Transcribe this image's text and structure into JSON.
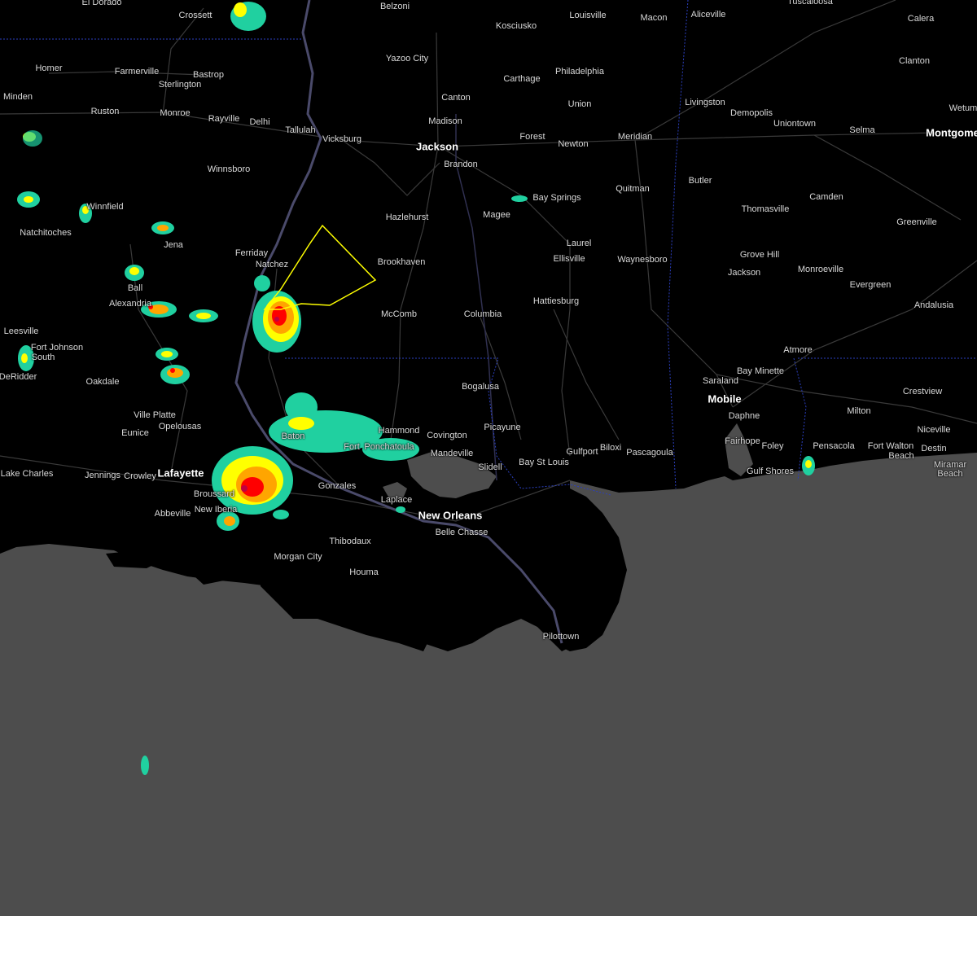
{
  "map": {
    "colors": {
      "land": "#000000",
      "water": "#4d4d4d",
      "roads": "#3a3a3a",
      "state_border": "#2b3fbf",
      "warning_polygon": "#ffff00",
      "label": "#d9d9d9"
    },
    "radar_color_scale": [
      "#18a884",
      "#20d0a0",
      "#ffff00",
      "#ffa500",
      "#ff0000",
      "#c00040"
    ],
    "cities": [
      {
        "name": "El Dorado",
        "major": false
      },
      {
        "name": "Crossett",
        "major": false
      },
      {
        "name": "Belzoni",
        "major": false
      },
      {
        "name": "Kosciusko",
        "major": false
      },
      {
        "name": "Louisville",
        "major": false
      },
      {
        "name": "Macon",
        "major": false
      },
      {
        "name": "Aliceville",
        "major": false
      },
      {
        "name": "Tuscaloosa",
        "major": false
      },
      {
        "name": "Calera",
        "major": false
      },
      {
        "name": "Clanton",
        "major": false
      },
      {
        "name": "Wetum",
        "major": false
      },
      {
        "name": "Montgome",
        "major": true
      },
      {
        "name": "Yazoo City",
        "major": false
      },
      {
        "name": "Homer",
        "major": false
      },
      {
        "name": "Farmerville",
        "major": false
      },
      {
        "name": "Bastrop",
        "major": false
      },
      {
        "name": "Sterlington",
        "major": false
      },
      {
        "name": "Minden",
        "major": false
      },
      {
        "name": "Ruston",
        "major": false
      },
      {
        "name": "Monroe",
        "major": false
      },
      {
        "name": "Rayville",
        "major": false
      },
      {
        "name": "Delhi",
        "major": false
      },
      {
        "name": "Tallulah",
        "major": false
      },
      {
        "name": "Vicksburg",
        "major": false
      },
      {
        "name": "Jackson",
        "major": true
      },
      {
        "name": "Canton",
        "major": false
      },
      {
        "name": "Madison",
        "major": false
      },
      {
        "name": "Carthage",
        "major": false
      },
      {
        "name": "Philadelphia",
        "major": false
      },
      {
        "name": "Union",
        "major": false
      },
      {
        "name": "Forest",
        "major": false
      },
      {
        "name": "Newton",
        "major": false
      },
      {
        "name": "Meridian",
        "major": false
      },
      {
        "name": "Livingston",
        "major": false
      },
      {
        "name": "Demopolis",
        "major": false
      },
      {
        "name": "Uniontown",
        "major": false
      },
      {
        "name": "Selma",
        "major": false
      },
      {
        "name": "Brandon",
        "major": false
      },
      {
        "name": "Winnsboro",
        "major": false
      },
      {
        "name": "Winnfield",
        "major": false
      },
      {
        "name": "Natchitoches",
        "major": false
      },
      {
        "name": "Jena",
        "major": false
      },
      {
        "name": "Ferriday",
        "major": false
      },
      {
        "name": "Natchez",
        "major": false
      },
      {
        "name": "Hazlehurst",
        "major": false
      },
      {
        "name": "Magee",
        "major": false
      },
      {
        "name": "Bay Springs",
        "major": false
      },
      {
        "name": "Quitman",
        "major": false
      },
      {
        "name": "Butler",
        "major": false
      },
      {
        "name": "Thomasville",
        "major": false
      },
      {
        "name": "Camden",
        "major": false
      },
      {
        "name": "Greenville",
        "major": false
      },
      {
        "name": "Brookhaven",
        "major": false
      },
      {
        "name": "Laurel",
        "major": false
      },
      {
        "name": "Ellisville",
        "major": false
      },
      {
        "name": "Waynesboro",
        "major": false
      },
      {
        "name": "Grove Hill",
        "major": false
      },
      {
        "name": "Jackson",
        "major": false
      },
      {
        "name": "Monroeville",
        "major": false
      },
      {
        "name": "Evergreen",
        "major": false
      },
      {
        "name": "Ball",
        "major": false
      },
      {
        "name": "Alexandria",
        "major": false
      },
      {
        "name": "McComb",
        "major": false
      },
      {
        "name": "Columbia",
        "major": false
      },
      {
        "name": "Hattiesburg",
        "major": false
      },
      {
        "name": "Andalusia",
        "major": false
      },
      {
        "name": "Leesville",
        "major": false
      },
      {
        "name": "Fort Johnson",
        "major": false
      },
      {
        "name": "South",
        "major": false
      },
      {
        "name": "DeRidder",
        "major": false
      },
      {
        "name": "Oakdale",
        "major": false
      },
      {
        "name": "Bogalusa",
        "major": false
      },
      {
        "name": "Atmore",
        "major": false
      },
      {
        "name": "Saraland",
        "major": false
      },
      {
        "name": "Bay Minette",
        "major": false
      },
      {
        "name": "Mobile",
        "major": true
      },
      {
        "name": "Crestview",
        "major": false
      },
      {
        "name": "Ville Platte",
        "major": false
      },
      {
        "name": "Opelousas",
        "major": false
      },
      {
        "name": "Eunice",
        "major": false
      },
      {
        "name": "Hammond",
        "major": false
      },
      {
        "name": "Covington",
        "major": false
      },
      {
        "name": "Mandeville",
        "major": false
      },
      {
        "name": "Picayune",
        "major": false
      },
      {
        "name": "Daphne",
        "major": false
      },
      {
        "name": "Milton",
        "major": false
      },
      {
        "name": "Niceville",
        "major": false
      },
      {
        "name": "Fairhope",
        "major": false
      },
      {
        "name": "Foley",
        "major": false
      },
      {
        "name": "Pensacola",
        "major": false
      },
      {
        "name": "Fort Walton",
        "major": false
      },
      {
        "name": "Beach",
        "major": false
      },
      {
        "name": "Destin",
        "major": false
      },
      {
        "name": "Miramar",
        "major": false
      },
      {
        "name": "Beach",
        "major": false
      },
      {
        "name": "Gulf Shores",
        "major": false
      },
      {
        "name": "Lake Charles",
        "major": false
      },
      {
        "name": "Jennings",
        "major": false
      },
      {
        "name": "Crowley",
        "major": false
      },
      {
        "name": "Lafayette",
        "major": true
      },
      {
        "name": "Gonzales",
        "major": false
      },
      {
        "name": "Slidell",
        "major": false
      },
      {
        "name": "Bay St Louis",
        "major": false
      },
      {
        "name": "Gulfport",
        "major": false
      },
      {
        "name": "Biloxi",
        "major": false
      },
      {
        "name": "Pascagoula",
        "major": false
      },
      {
        "name": "Broussard",
        "major": false
      },
      {
        "name": "Laplace",
        "major": false
      },
      {
        "name": "New Orleans",
        "major": true
      },
      {
        "name": "Abbeville",
        "major": false
      },
      {
        "name": "New Iberia",
        "major": false
      },
      {
        "name": "Belle Chasse",
        "major": false
      },
      {
        "name": "Thibodaux",
        "major": false
      },
      {
        "name": "Morgan City",
        "major": false
      },
      {
        "name": "Houma",
        "major": false
      },
      {
        "name": "Pilottown",
        "major": false
      },
      {
        "name": "Fort",
        "major": false
      },
      {
        "name": "Ponchatoula",
        "major": false
      },
      {
        "name": "Baton",
        "major": false
      }
    ]
  }
}
